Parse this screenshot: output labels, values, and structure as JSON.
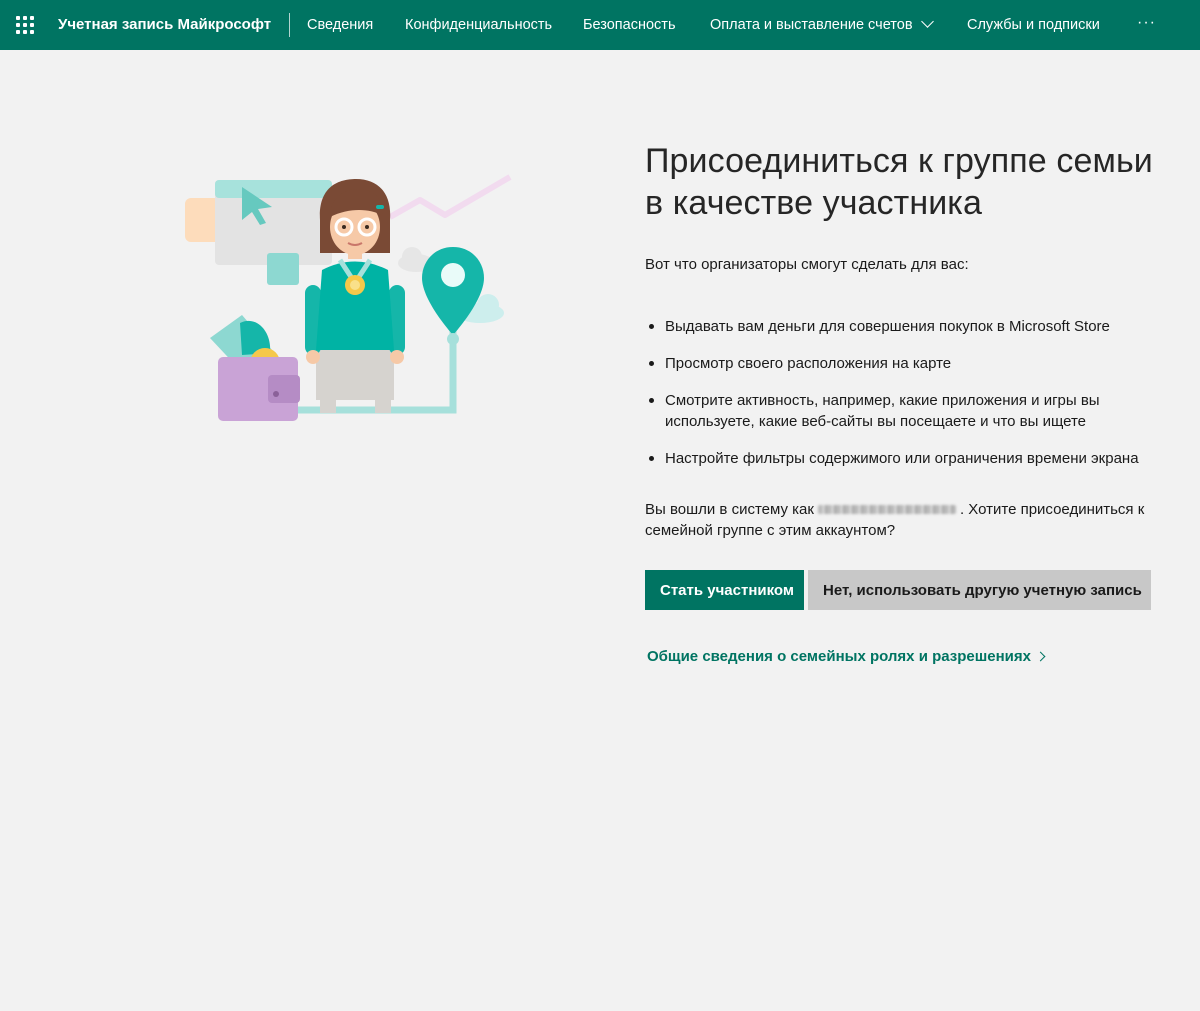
{
  "nav": {
    "brand": "Учетная запись Майкрософт",
    "items": [
      {
        "label": "Сведения"
      },
      {
        "label": "Конфиденциальность"
      },
      {
        "label": "Безопасность"
      },
      {
        "label": "Оплата и выставление счетов"
      },
      {
        "label": "Службы и подписки"
      }
    ],
    "more": "···",
    "background": "#007462"
  },
  "main": {
    "title": "Присоединиться к группе семьи в качестве участника",
    "intro": "Вот что организаторы смогут сделать для вас:",
    "bullets": [
      "Выдавать вам деньги для совершения покупок в Microsoft Store",
      "Просмотр своего расположения на карте",
      "Смотрите активность, например, какие приложения и игры вы используете, какие веб-сайты вы посещаете и что вы ищете",
      "Настройте фильтры содержимого или ограничения времени экрана"
    ],
    "signed_in_prefix": "Вы вошли в систему как",
    "signed_in_suffix": ". Хотите присоединиться к семейной группе с этим аккаунтом?",
    "primary_button": "Стать участником",
    "secondary_button": "Нет, использовать другую учетную запись",
    "link": "Общие сведения о семейных ролях и разрешениях"
  },
  "colors": {
    "accent": "#007462",
    "page_bg": "#f2f2f2",
    "secondary_button": "#c8c8c8"
  }
}
